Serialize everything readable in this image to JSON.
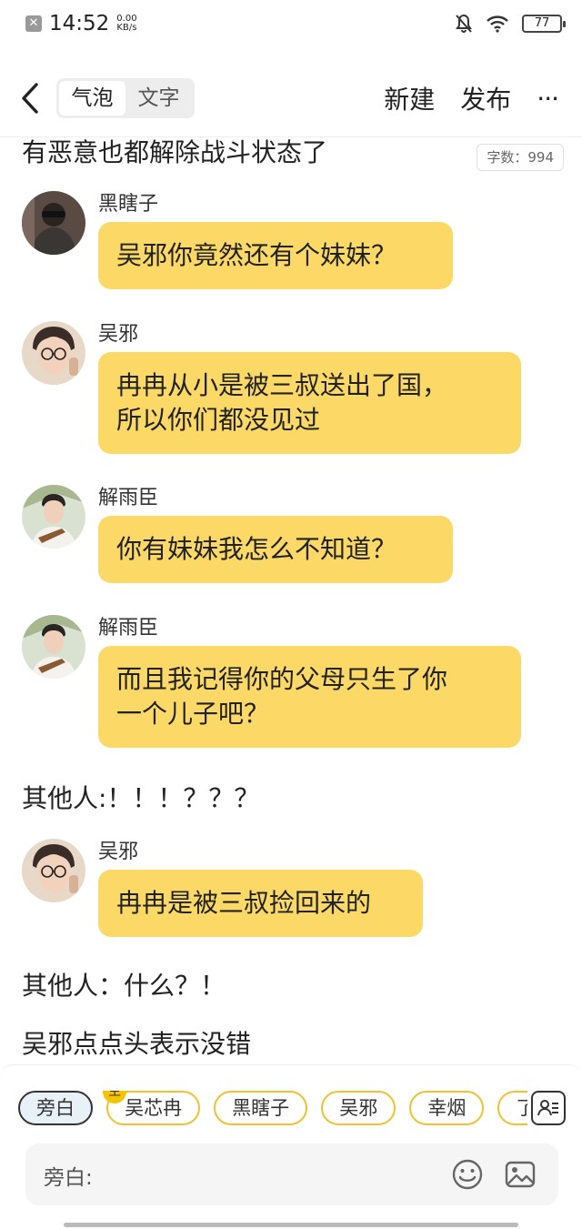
{
  "status_bar": {
    "time": "14:52",
    "speed_value": "0.00",
    "speed_unit": "KB/s",
    "battery": "77"
  },
  "toolbar": {
    "mode_tabs": [
      "气泡",
      "文字"
    ],
    "active_tab": "气泡",
    "new_label": "新建",
    "publish_label": "发布",
    "more_label": "···"
  },
  "word_count": "字数：994",
  "content": {
    "intro": "有恶意也都解除战斗状态了",
    "messages": [
      {
        "name": "黑瞎子",
        "lines": [
          "吴邪你竟然还有个妹妹？"
        ]
      },
      {
        "name": "吴邪",
        "lines": [
          "冉冉从小是被三叔送出了国，",
          "所以你们都没见过"
        ]
      },
      {
        "name": "解雨臣",
        "lines": [
          "你有妹妹我怎么不知道？"
        ]
      },
      {
        "name": "解雨臣",
        "lines": [
          "而且我记得你的父母只生了你",
          "一个儿子吧？"
        ]
      }
    ],
    "narration_1": "其他人:！！！？？？",
    "message_5": {
      "name": "吴邪",
      "lines": [
        "冉冉是被三叔捡回来的"
      ]
    },
    "narration_2": "其他人：什么？！",
    "narration_3": "吴邪点点头表示没错"
  },
  "bottom": {
    "roles": [
      "旁白",
      "吴芯冉",
      "黑瞎子",
      "吴邪",
      "幸烟",
      "了"
    ],
    "selected_role": "旁白",
    "main_badge": "主",
    "input_placeholder": "旁白:"
  },
  "colors": {
    "bubble": "#fcd966",
    "accent": "#f0c22f"
  },
  "icons": [
    "back-arrow-icon",
    "mute-bell-icon",
    "wifi-icon",
    "battery-icon",
    "role-manager-icon",
    "emoji-icon",
    "image-icon"
  ]
}
